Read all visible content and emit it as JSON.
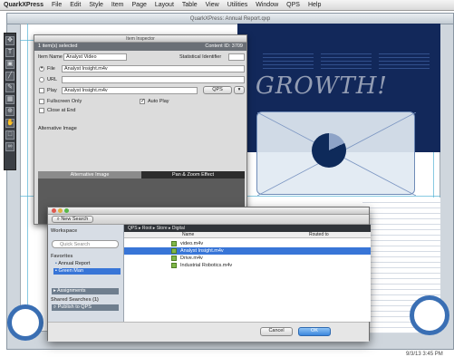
{
  "menubar": {
    "app_name": "QuarkXPress",
    "items": [
      "File",
      "Edit",
      "Style",
      "Item",
      "Page",
      "Layout",
      "Table",
      "View",
      "Utilities",
      "Window",
      "QPS",
      "Help"
    ]
  },
  "document": {
    "title": "QuarkXPress: Annual Report.qxp",
    "headline": "GROWTH!"
  },
  "palette": {
    "title": "Item Inspector",
    "header_left": "1 item(s) selected",
    "header_right": "Content ID: 3709",
    "item_name_label": "Item Name",
    "item_name_value": "Analyst Video",
    "statistical_identifier_label": "Statistical Identifier",
    "file_label": "File",
    "file_value": "Analyst Insight.m4v",
    "url_label": "URL",
    "play_label": "Play",
    "play_value": "Analyst Insight.m4v",
    "qps_button": "QPS",
    "fullscreen_label": "Fullscreen Only",
    "autoplay_label": "Auto Play",
    "close_at_end_label": "Close at End",
    "alternative_image_label": "Alternative Image",
    "tabs": [
      "Alternative Image",
      "Pan & Zoom Effect"
    ]
  },
  "dialog": {
    "toolbar_button": "New Search",
    "workspace_label": "Workspace",
    "search_placeholder": "Quick Search",
    "favorites_label": "Favorites",
    "favorites": [
      "Annual Report",
      "Green Man"
    ],
    "assignments_label": "Assignments",
    "shared_searches_label": "Shared Searches (1)",
    "shared_searches": [
      "Publish to QPS"
    ],
    "path_bar": "QPS ▸ Root ▸ Store ▸ Digital",
    "columns": [
      "Name",
      "Routed to"
    ],
    "files": [
      {
        "name": "video.m4v",
        "selected": false
      },
      {
        "name": "Analyst Insight.m4v",
        "selected": true
      },
      {
        "name": "Drive.m4v",
        "selected": false
      },
      {
        "name": "Industrial Robotics.m4v",
        "selected": false
      }
    ],
    "cancel_label": "Cancel",
    "ok_label": "OK"
  },
  "status": {
    "clock": "9/3/13 3:45 PM"
  },
  "colors": {
    "accent": "#3875d7",
    "document_blue": "#12285a",
    "guide": "#56b4d6"
  }
}
